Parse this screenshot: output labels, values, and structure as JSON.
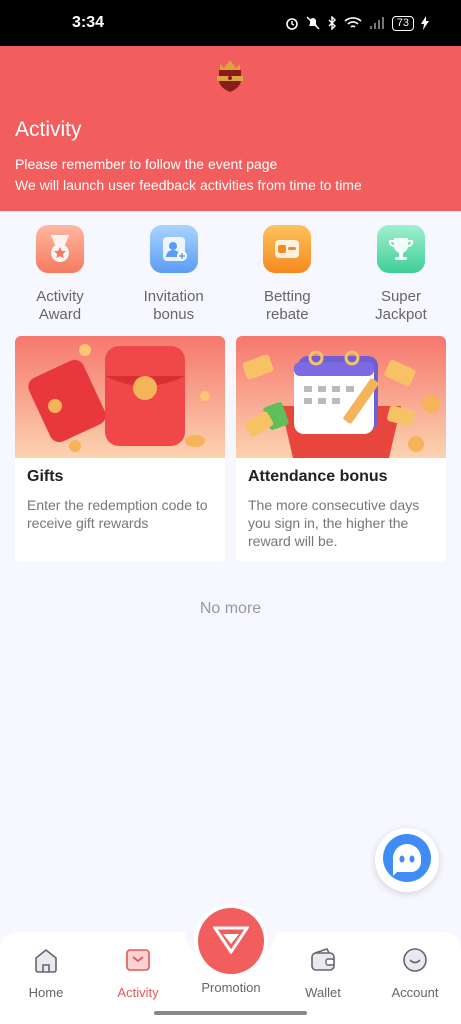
{
  "status_bar": {
    "time": "3:34",
    "battery": "73"
  },
  "header": {
    "title": "Activity",
    "desc_line1": "Please remember to follow the event page",
    "desc_line2": "We will launch user feedback activities from time to time",
    "bg_color": "#f25d5d"
  },
  "categories": [
    {
      "label_1": "Activity",
      "label_2": "Award",
      "icon": "medal-icon"
    },
    {
      "label_1": "Invitation",
      "label_2": "bonus",
      "icon": "invite-user-icon"
    },
    {
      "label_1": "Betting",
      "label_2": "rebate",
      "icon": "rebate-icon"
    },
    {
      "label_1": "Super",
      "label_2": "Jackpot",
      "icon": "trophy-icon"
    }
  ],
  "cards": [
    {
      "title": "Gifts",
      "desc": "Enter the redemption code to receive gift rewards"
    },
    {
      "title": "Attendance bonus",
      "desc": "The more consecutive days you sign in, the higher the reward will be."
    }
  ],
  "list_end": "No more",
  "bottom_nav": [
    {
      "label": "Home",
      "icon": "home-icon"
    },
    {
      "label": "Activity",
      "icon": "activity-icon",
      "active": true
    },
    {
      "label": "Promotion",
      "icon": "promotion-icon"
    },
    {
      "label": "Wallet",
      "icon": "wallet-icon"
    },
    {
      "label": "Account",
      "icon": "account-icon"
    }
  ]
}
